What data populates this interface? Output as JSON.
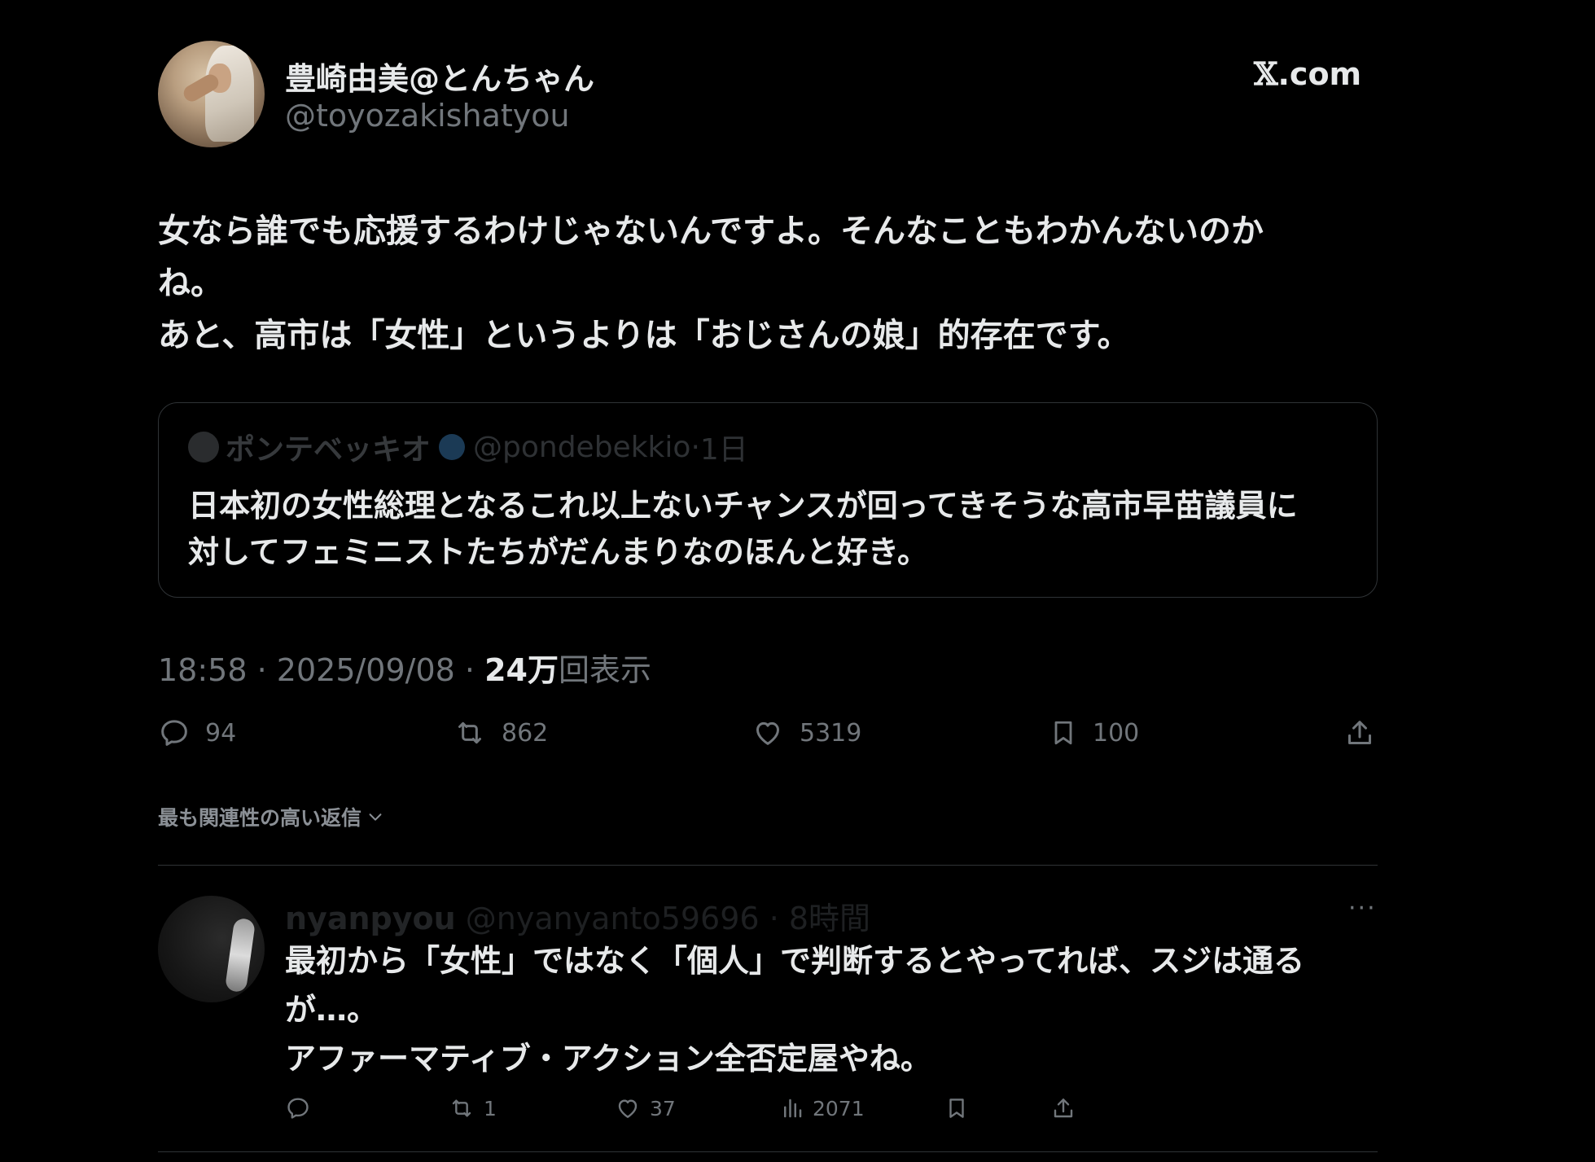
{
  "header": {
    "display_name": "豊崎由美@とんちゃん",
    "handle": "@toyozakishatyou",
    "site_glyph": "𝕏",
    "site_suffix": ".com"
  },
  "tweet": {
    "lines": [
      "女なら誰でも応援するわけじゃないんですよ。そんなこともわかんないのか",
      "ね。",
      "あと、高市は「女性」というよりは「おじさんの娘」的存在です。"
    ],
    "time": "18:58",
    "date": "2025/09/08",
    "views_count": "24万",
    "views_label": "回表示",
    "separator": "·"
  },
  "quote": {
    "name": "ポンテベッキオ",
    "handle": "@pondebekkio",
    "age": "1日",
    "lines": [
      "日本初の女性総理となるこれ以上ないチャンスが回ってきそうな高市早苗議員に",
      "対してフェミニストたちがだんまりなのほんと好き。"
    ]
  },
  "actions": {
    "replies": "94",
    "reposts": "862",
    "likes": "5319",
    "bookmarks": "100"
  },
  "sort": {
    "label": "最も関連性の高い返信"
  },
  "reply": {
    "name": "nyanpyou",
    "handle": "@nyanyanto59696",
    "age": "8時間",
    "more": "···",
    "lines": [
      "最初から「女性」ではなく「個人」で判断するとやってれば、スジは通る",
      "が…。",
      "アファーマティブ・アクション全否定屋やね。"
    ],
    "actions": {
      "replies": "",
      "reposts": "1",
      "likes": "37",
      "views": "2071"
    }
  },
  "colors": {
    "background": "#000000",
    "text": "#e7e9ea",
    "muted": "#71767b",
    "border": "#2f3336"
  }
}
